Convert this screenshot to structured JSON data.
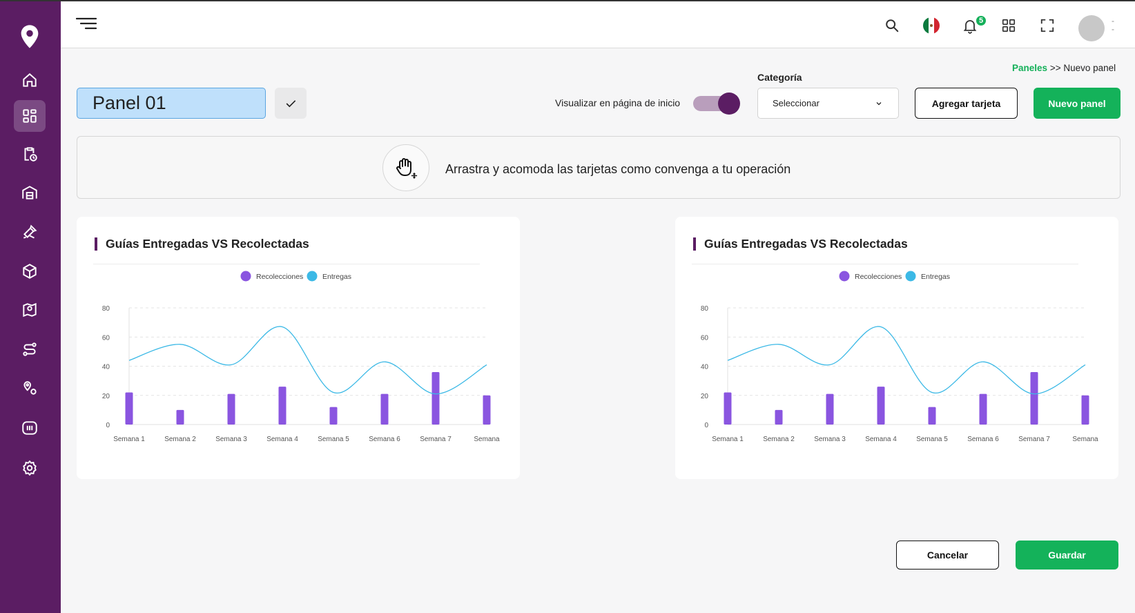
{
  "header": {
    "notification_count": "5",
    "icons": [
      "menu-icon",
      "search-icon",
      "mexico-flag-icon",
      "bell-icon",
      "apps-grid-icon",
      "fullscreen-icon",
      "avatar"
    ],
    "avatar_menu": "-\n-"
  },
  "sidebar": {
    "items": [
      {
        "name": "home-icon",
        "active": false
      },
      {
        "name": "dashboard-icon",
        "active": true
      },
      {
        "name": "clipboard-clock-icon",
        "active": false
      },
      {
        "name": "warehouse-icon",
        "active": false
      },
      {
        "name": "tools-icon",
        "active": false
      },
      {
        "name": "package-icon",
        "active": false
      },
      {
        "name": "map-pin-icon",
        "active": false
      },
      {
        "name": "route-icon",
        "active": false
      },
      {
        "name": "locations-icon",
        "active": false
      },
      {
        "name": "tracking-icon",
        "active": false
      },
      {
        "name": "settings-icon",
        "active": false
      }
    ]
  },
  "breadcrumb": {
    "link": "Paneles",
    "separator": ">>",
    "current": "Nuevo panel"
  },
  "toolbar": {
    "panel_name": "Panel 01",
    "toggle_label": "Visualizar en página de inicio",
    "toggle_on": true,
    "category_label": "Categoría",
    "category_value": "Seleccionar",
    "add_card_label": "Agregar tarjeta",
    "new_panel_label": "Nuevo panel"
  },
  "info": {
    "text": "Arrastra y acomoda las tarjetas como  convenga a tu operación"
  },
  "colors": {
    "primary": "#5b1d63",
    "green": "#14b25a",
    "bar": "#8a55e0",
    "line": "#3cb9e6"
  },
  "cards": [
    {
      "title": "Guías Entregadas VS Recolectadas"
    },
    {
      "title": "Guías Entregadas VS Recolectadas"
    }
  ],
  "chart_data": [
    {
      "type": "bar",
      "legend": [
        "Recolecciones",
        "Entregas"
      ],
      "categories": [
        "Semana 1",
        "Semana 2",
        "Semana 3",
        "Semana 4",
        "Semana 5",
        "Semana 6",
        "Semana 7",
        "Semana"
      ],
      "yticks": [
        0,
        20,
        40,
        60,
        80
      ],
      "ylim": [
        0,
        80
      ],
      "series": [
        {
          "name": "Recolecciones",
          "type": "bar",
          "values": [
            22,
            10,
            21,
            26,
            12,
            21,
            36,
            20
          ]
        },
        {
          "name": "Entregas",
          "type": "line",
          "values": [
            44,
            55,
            41,
            67,
            22,
            43,
            21,
            41
          ]
        }
      ]
    },
    {
      "type": "bar",
      "legend": [
        "Recolecciones",
        "Entregas"
      ],
      "categories": [
        "Semana 1",
        "Semana 2",
        "Semana 3",
        "Semana 4",
        "Semana 5",
        "Semana 6",
        "Semana 7",
        "Semana"
      ],
      "yticks": [
        0,
        20,
        40,
        60,
        80
      ],
      "ylim": [
        0,
        80
      ],
      "series": [
        {
          "name": "Recolecciones",
          "type": "bar",
          "values": [
            22,
            10,
            21,
            26,
            12,
            21,
            36,
            20
          ]
        },
        {
          "name": "Entregas",
          "type": "line",
          "values": [
            44,
            55,
            41,
            67,
            22,
            43,
            21,
            41
          ]
        }
      ]
    }
  ],
  "footer": {
    "cancel_label": "Cancelar",
    "save_label": "Guardar"
  }
}
